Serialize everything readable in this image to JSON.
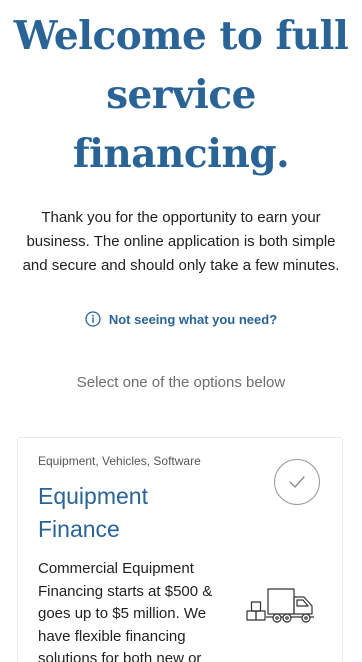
{
  "hero": {
    "title_line1": "Welcome to full",
    "title_line2": "service",
    "title_line3": "financing."
  },
  "intro": {
    "text": "Thank you for the opportunity to earn your business. The online application is both simple and secure and should only take a few minutes."
  },
  "help": {
    "icon": "info-icon",
    "label": "Not seeing what you need?"
  },
  "options": {
    "prompt": "Select one of the options below",
    "cards": [
      {
        "tags": "Equipment, Vehicles, Software",
        "title_line1": "Equipment",
        "title_line2": "Finance",
        "description": "Commercial Equipment Financing starts at $500 & goes up to $5 million. We have flexible financing solutions for both new or",
        "icon": "truck-icon",
        "selected": false
      }
    ]
  },
  "colors": {
    "brand": "#2a6496",
    "text": "#1f1f1f",
    "muted": "#6d6d6d",
    "border": "#e6e6e6"
  }
}
